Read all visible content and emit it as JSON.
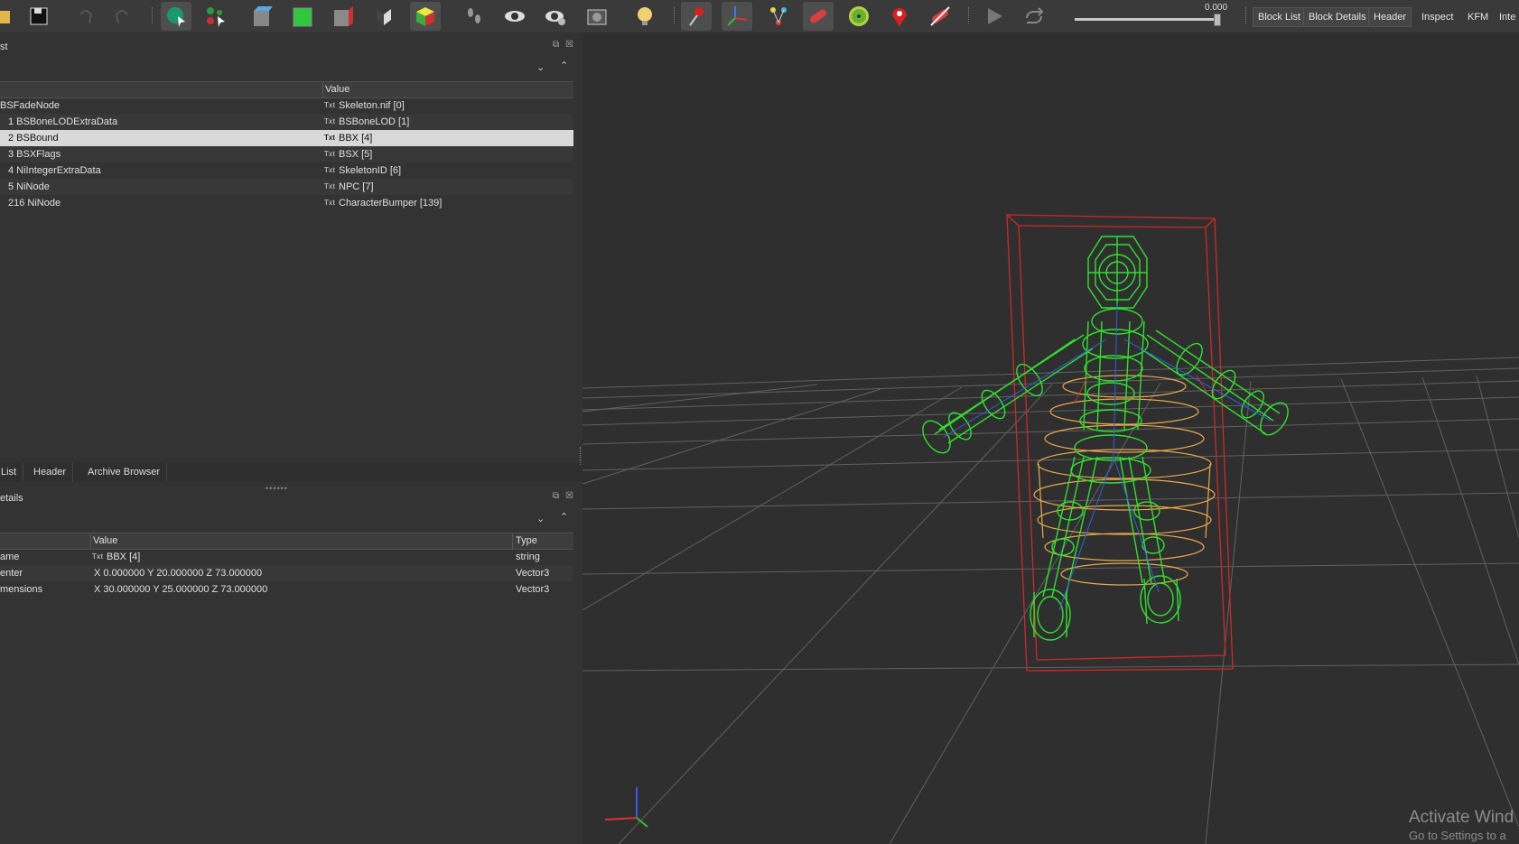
{
  "toolbar": {
    "slider_value": "0.000",
    "tabs": [
      "Block List",
      "Block Details",
      "Header",
      "Inspect",
      "KFM",
      "Inte"
    ]
  },
  "block_list": {
    "title": "st",
    "col_value": "Value",
    "rows": [
      {
        "name": "BSFadeNode",
        "value": "Skeleton.nif [0]"
      },
      {
        "name": "1 BSBoneLODExtraData",
        "value": "BSBoneLOD [1]"
      },
      {
        "name": "2 BSBound",
        "value": "BBX [4]"
      },
      {
        "name": "3 BSXFlags",
        "value": "BSX [5]"
      },
      {
        "name": "4 NiIntegerExtraData",
        "value": "SkeletonID [6]"
      },
      {
        "name": "5 NiNode",
        "value": "NPC [7]"
      },
      {
        "name": "216 NiNode",
        "value": "CharacterBumper [139]"
      }
    ],
    "icon_label": "Txt"
  },
  "bottom_tabs": [
    "List",
    "Header",
    "Archive Browser"
  ],
  "block_details": {
    "title": "etails",
    "col_value": "Value",
    "col_type": "Type",
    "rows": [
      {
        "name": "ame",
        "value": "BBX [4]",
        "type": "string",
        "has_icon": true
      },
      {
        "name": "enter",
        "value": "X 0.000000 Y 20.000000 Z 73.000000",
        "type": "Vector3",
        "has_icon": false
      },
      {
        "name": "mensions",
        "value": "X 30.000000 Y 25.000000 Z 73.000000",
        "type": "Vector3",
        "has_icon": false
      }
    ]
  },
  "watermark": {
    "line1": "Activate Wind",
    "line2": "Go to Settings to a"
  }
}
